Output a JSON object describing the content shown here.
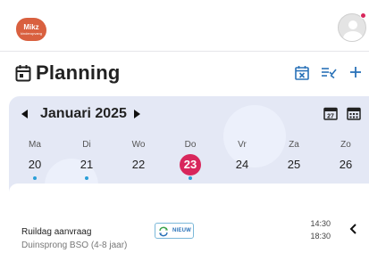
{
  "topbar": {
    "logo_line1": "Mikz",
    "logo_line2": "kinderopvang",
    "logo_color": "#d9603f",
    "avatar_icon": "user-avatar-icon",
    "notification_color": "#d8275c"
  },
  "header": {
    "title": "Planning",
    "icon": "calendar-icon",
    "actions": [
      {
        "name": "calendar-cancel-icon"
      },
      {
        "name": "filter-check-icon"
      },
      {
        "name": "plus-icon"
      }
    ],
    "accent": "#2a72b8"
  },
  "calendar": {
    "month_label": "Januari 2025",
    "prev_icon": "caret-left-icon",
    "next_icon": "caret-right-icon",
    "view_icons": [
      "calendar-day-icon",
      "calendar-week-icon"
    ],
    "days": [
      {
        "name": "Ma",
        "date": "20",
        "has_event": true,
        "selected": false
      },
      {
        "name": "Di",
        "date": "21",
        "has_event": true,
        "selected": false
      },
      {
        "name": "Wo",
        "date": "22",
        "has_event": false,
        "selected": false
      },
      {
        "name": "Do",
        "date": "23",
        "has_event": true,
        "selected": true
      },
      {
        "name": "Vr",
        "date": "24",
        "has_event": false,
        "selected": false
      },
      {
        "name": "Za",
        "date": "25",
        "has_event": false,
        "selected": false
      },
      {
        "name": "Zo",
        "date": "26",
        "has_event": false,
        "selected": false
      }
    ],
    "selected_color": "#d8275c",
    "event_dot_color": "#2a9fd8",
    "background": "#e4e8f5"
  },
  "event": {
    "title": "Ruildag aanvraag",
    "subtitle": "Duinsprong BSO (4-8 jaar)",
    "badge": "NIEUW",
    "badge_icon": "swap-icon",
    "start_time": "14:30",
    "end_time": "18:30",
    "expand_icon": "chevron-left-icon"
  }
}
